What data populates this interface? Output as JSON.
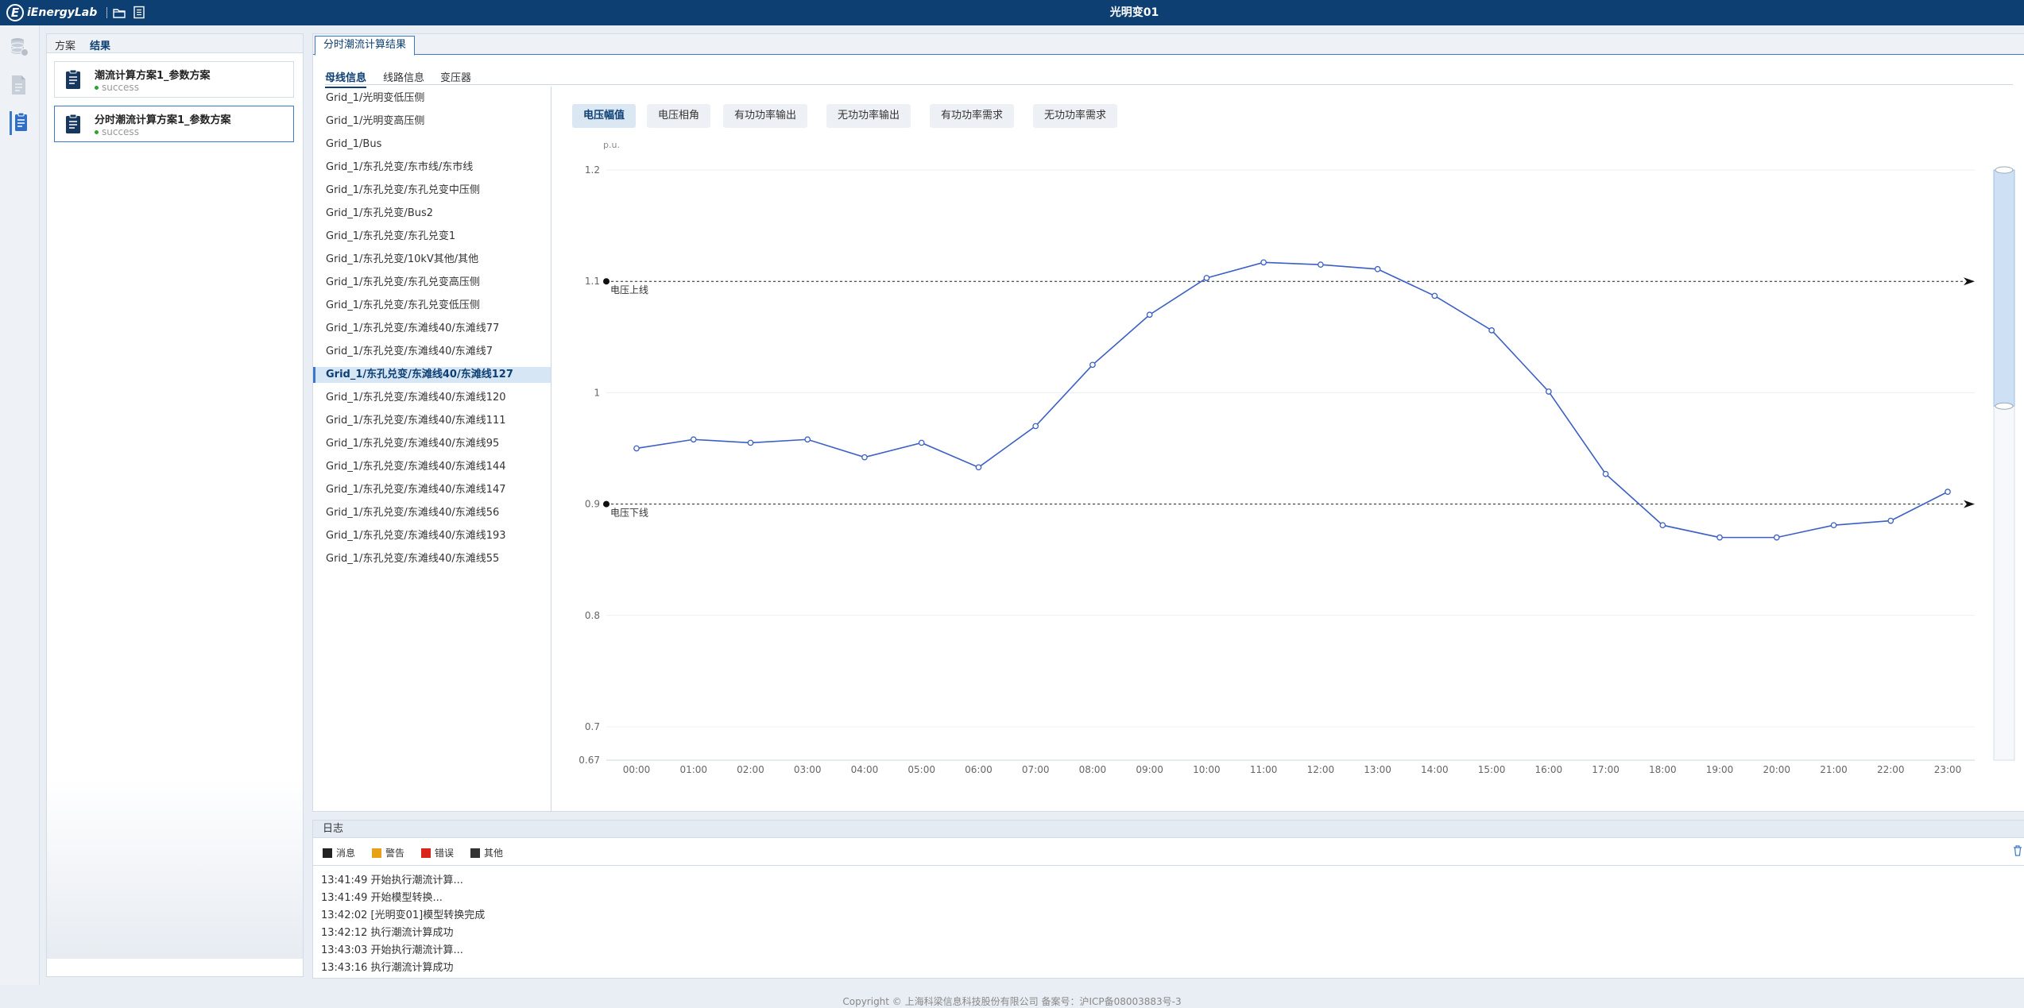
{
  "app": {
    "logo_mark": "E",
    "logo_text": "iEnergyLab",
    "window_title": "光明变01",
    "icons": [
      "folder-icon",
      "document-list-icon"
    ]
  },
  "rail": {
    "items": [
      {
        "icon": "database-icon",
        "active": false
      },
      {
        "icon": "file-report-icon",
        "active": false
      },
      {
        "icon": "result-report-icon",
        "active": true
      }
    ]
  },
  "scheme_panel": {
    "tabs": [
      {
        "label": "方案",
        "active": false
      },
      {
        "label": "结果",
        "active": true
      }
    ],
    "results": [
      {
        "name": "潮流计算方案1_参数方案",
        "status": "success",
        "active": false
      },
      {
        "name": "分时潮流计算方案1_参数方案",
        "status": "success",
        "active": true
      }
    ]
  },
  "main": {
    "tab": "分时潮流计算结果",
    "sub_tabs": [
      {
        "label": "母线信息",
        "active": true
      },
      {
        "label": "线路信息",
        "active": false
      },
      {
        "label": "变压器",
        "active": false
      }
    ],
    "buses": [
      "Grid_1/光明变低压侧",
      "Grid_1/光明变高压侧",
      "Grid_1/Bus",
      "Grid_1/东孔兑变/东市线/东市线",
      "Grid_1/东孔兑变/东孔兑变中压侧",
      "Grid_1/东孔兑变/Bus2",
      "Grid_1/东孔兑变/东孔兑变1",
      "Grid_1/东孔兑变/10kV其他/其他",
      "Grid_1/东孔兑变/东孔兑变高压侧",
      "Grid_1/东孔兑变/东孔兑变低压侧",
      "Grid_1/东孔兑变/东滩线40/东滩线77",
      "Grid_1/东孔兑变/东滩线40/东滩线7",
      "Grid_1/东孔兑变/东滩线40/东滩线127",
      "Grid_1/东孔兑变/东滩线40/东滩线120",
      "Grid_1/东孔兑变/东滩线40/东滩线111",
      "Grid_1/东孔兑变/东滩线40/东滩线95",
      "Grid_1/东孔兑变/东滩线40/东滩线144",
      "Grid_1/东孔兑变/东滩线40/东滩线147",
      "Grid_1/东孔兑变/东滩线40/东滩线56",
      "Grid_1/东孔兑变/东滩线40/东滩线193",
      "Grid_1/东孔兑变/东滩线40/东滩线55"
    ],
    "selected_bus_index": 12,
    "metric_buttons": [
      {
        "label": "电压幅值",
        "active": true
      },
      {
        "label": "电压相角",
        "active": false
      },
      {
        "label": "有功功率输出",
        "active": false
      },
      {
        "label": "无功功率输出",
        "active": false
      },
      {
        "label": "有功功率需求",
        "active": false
      },
      {
        "label": "无功功率需求",
        "active": false
      }
    ]
  },
  "chart_data": {
    "type": "line",
    "ylabel": "p.u.",
    "ylim": [
      0.67,
      1.2
    ],
    "yticks": [
      0.67,
      0.7,
      0.8,
      0.9,
      1,
      1.1,
      1.2
    ],
    "ytick_labels": [
      "0.67",
      "0.7",
      "0.8",
      "0.9",
      "1",
      "1.1",
      "1.2"
    ],
    "categories": [
      "00:00",
      "01:00",
      "02:00",
      "03:00",
      "04:00",
      "05:00",
      "06:00",
      "07:00",
      "08:00",
      "09:00",
      "10:00",
      "11:00",
      "12:00",
      "13:00",
      "14:00",
      "15:00",
      "16:00",
      "17:00",
      "18:00",
      "19:00",
      "20:00",
      "21:00",
      "22:00",
      "23:00"
    ],
    "series": [
      {
        "values": [
          0.95,
          0.958,
          0.955,
          0.958,
          0.942,
          0.955,
          0.933,
          0.97,
          1.025,
          1.07,
          1.103,
          1.117,
          1.115,
          1.111,
          1.087,
          1.056,
          1.001,
          0.927,
          0.881,
          0.87,
          0.87,
          0.881,
          0.885,
          0.911
        ],
        "color": "#3b5fc4"
      }
    ],
    "mark_lines": [
      {
        "label": "电压上线",
        "value": 1.1
      },
      {
        "label": "电压下线",
        "value": 0.9
      }
    ],
    "grid": true,
    "zoom_slider": {
      "start": 0.6,
      "end": 1.0
    }
  },
  "log": {
    "title": "日志",
    "filters": [
      {
        "label": "消息",
        "color": "#222222"
      },
      {
        "label": "警告",
        "color": "#e6a117"
      },
      {
        "label": "错误",
        "color": "#d9251c"
      },
      {
        "label": "其他",
        "color": "#333333"
      }
    ],
    "lines": [
      "13:41:49 开始执行潮流计算...",
      "13:41:49 开始模型转换...",
      "13:42:02 [光明变01]模型转换完成",
      "13:42:12 执行潮流计算成功",
      "13:43:03 开始执行潮流计算...",
      "13:43:16 执行潮流计算成功"
    ]
  },
  "footer": "Copyright © 上海科梁信息科技股份有限公司 备案号：沪ICP备08003883号-3"
}
